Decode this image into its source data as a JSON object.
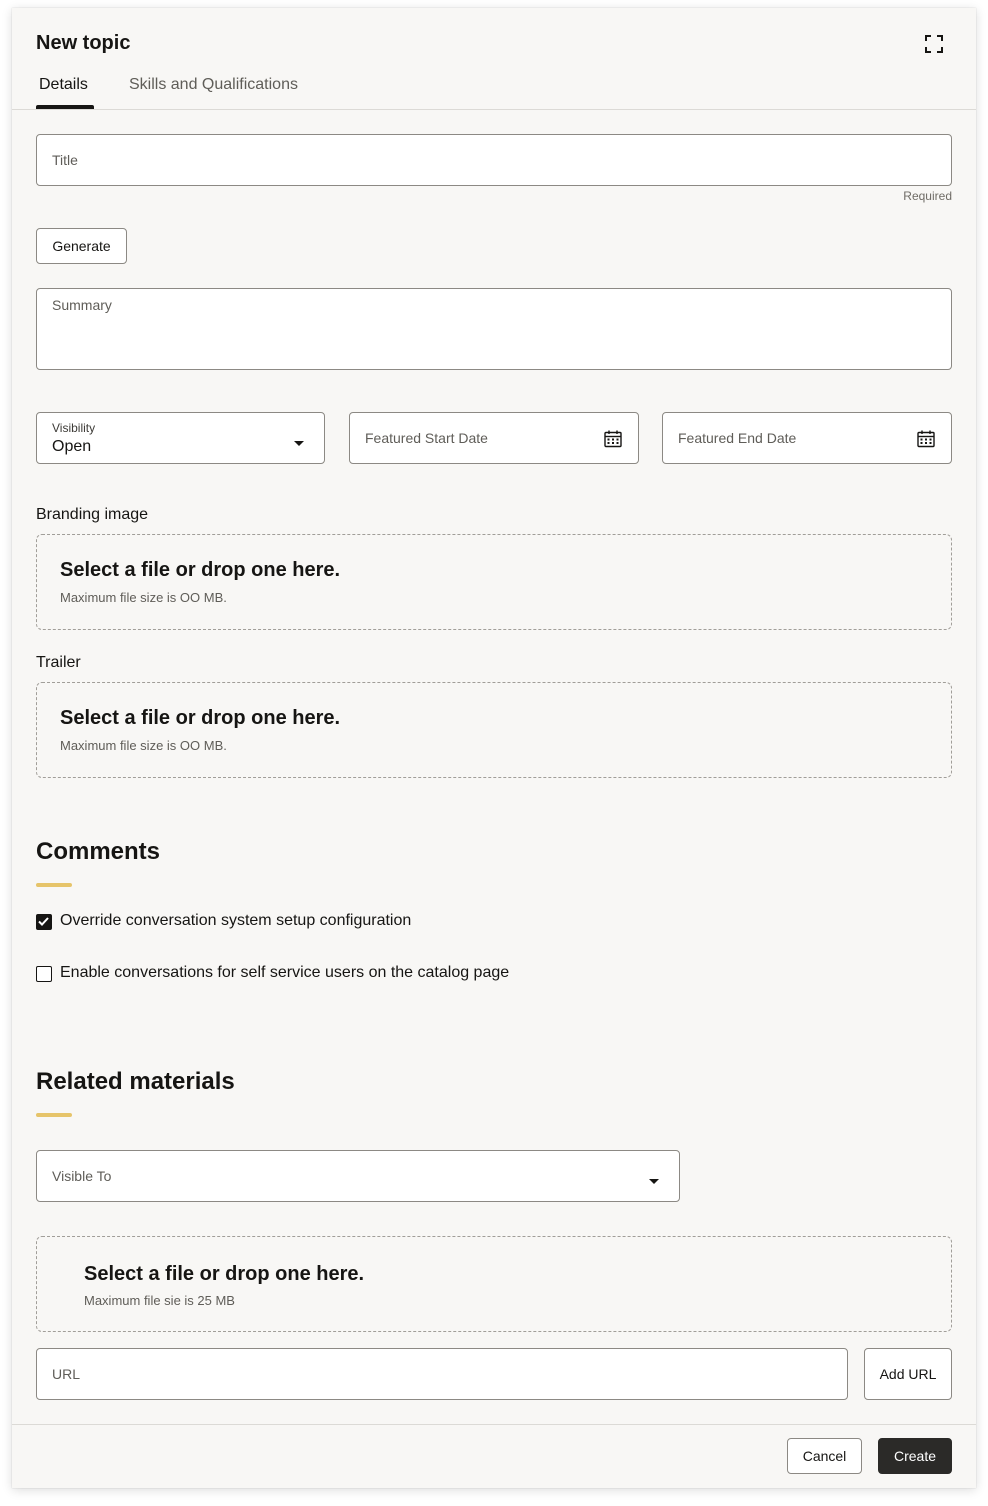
{
  "dialog": {
    "title": "New topic"
  },
  "tabs": [
    {
      "label": "Details",
      "active": true
    },
    {
      "label": "Skills and Qualifications",
      "active": false
    }
  ],
  "icons": {
    "expand": "expand-icon",
    "calendar": "calendar-icon",
    "dropdown": "chevron-down-icon",
    "checkmark": "checkmark-icon"
  },
  "form": {
    "title_placeholder": "Title",
    "title_helper": "Required",
    "generate_label": "Generate",
    "summary_placeholder": "Summary",
    "visibility": {
      "label": "Visibility",
      "value": "Open"
    },
    "featured_start_placeholder": "Featured Start Date",
    "featured_end_placeholder": "Featured End Date"
  },
  "branding": {
    "label": "Branding image",
    "drop_title": "Select a file or drop one here.",
    "drop_sub": "Maximum file size is OO MB."
  },
  "trailer": {
    "label": "Trailer",
    "drop_title": "Select a file or drop one here.",
    "drop_sub": "Maximum file size is OO MB."
  },
  "comments": {
    "heading": "Comments",
    "options": [
      {
        "label": "Override conversation system setup configuration",
        "checked": true
      },
      {
        "label": "Enable conversations for self service users on the catalog page",
        "checked": false
      }
    ]
  },
  "related": {
    "heading": "Related materials",
    "visible_to_placeholder": "Visible To",
    "drop_title": "Select a file or drop one here.",
    "drop_sub": "Maximum file sie is 25 MB",
    "url_placeholder": "URL",
    "add_url_label": "Add URL"
  },
  "footer": {
    "cancel_label": "Cancel",
    "create_label": "Create"
  },
  "colors": {
    "accent": "#e6c46a",
    "primary_button": "#2b2a28",
    "surface": "#f8f7f5"
  }
}
